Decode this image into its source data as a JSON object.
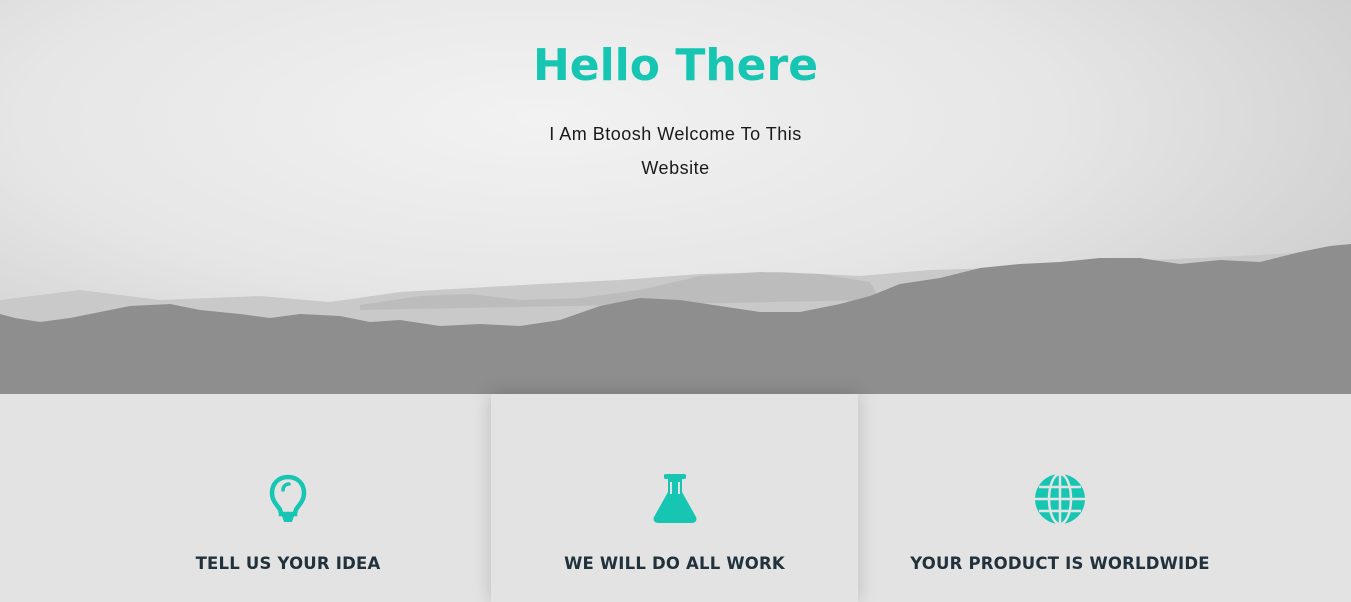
{
  "hero": {
    "title": "Hello There",
    "subtitle": "I Am Btoosh Welcome To This Website"
  },
  "features": [
    {
      "label": "TELL US YOUR IDEA",
      "icon": "lightbulb-icon"
    },
    {
      "label": "WE WILL DO ALL WORK",
      "icon": "flask-icon"
    },
    {
      "label": "YOUR PRODUCT IS WORLDWIDE",
      "icon": "globe-icon"
    }
  ],
  "colors": {
    "accent": "#17c6b2",
    "heading": "#21323d",
    "background": "#e3e3e3"
  }
}
